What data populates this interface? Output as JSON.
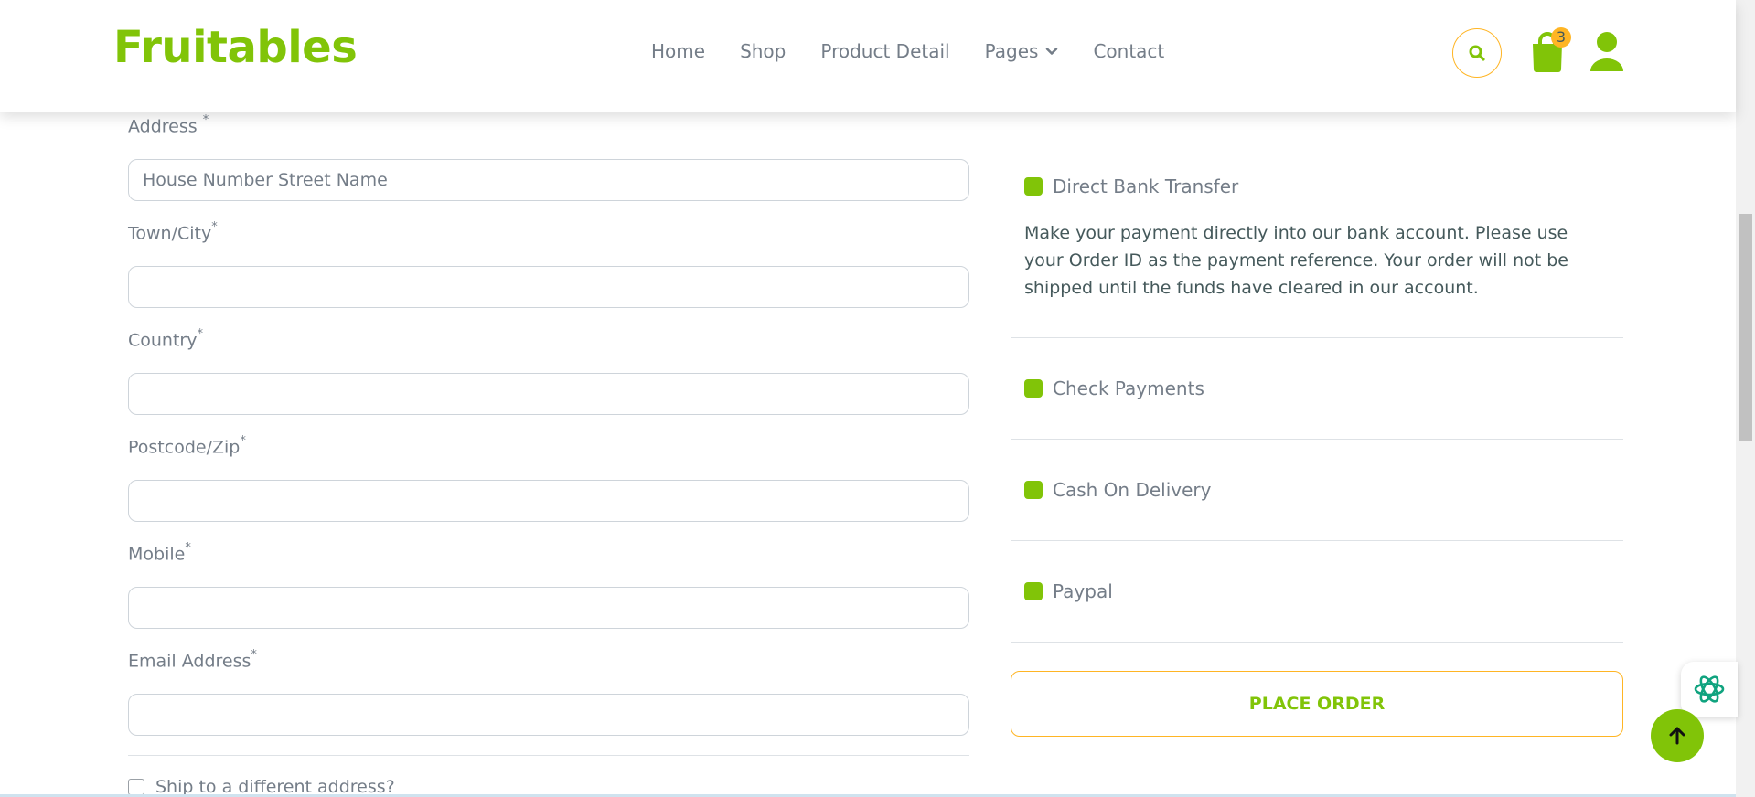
{
  "header": {
    "brand": "Fruitables",
    "nav": [
      "Home",
      "Shop",
      "Product Detail",
      "Pages",
      "Contact"
    ],
    "cart_count": "3",
    "icons": [
      "search-icon",
      "shopping-bag-icon",
      "user-icon"
    ]
  },
  "form": {
    "address": {
      "label": "Address",
      "required": "*",
      "placeholder": "House Number Street Name",
      "value": ""
    },
    "town": {
      "label": "Town/City",
      "required": "*",
      "value": ""
    },
    "country": {
      "label": "Country",
      "required": "*",
      "value": ""
    },
    "postcode": {
      "label": "Postcode/Zip",
      "required": "*",
      "value": ""
    },
    "mobile": {
      "label": "Mobile",
      "required": "*",
      "value": ""
    },
    "email": {
      "label": "Email Address",
      "required": "*",
      "value": ""
    },
    "ship_different": "Ship to a different address?"
  },
  "payment": {
    "options": [
      "Direct Bank Transfer",
      "Check Payments",
      "Cash On Delivery",
      "Paypal"
    ],
    "bank_description": "Make your payment directly into our bank account. Please use your Order ID as the payment reference. Your order will not be shipped until the funds have cleared in our account.",
    "place_order": "PLACE ORDER"
  },
  "colors": {
    "brand_green": "#81c408",
    "accent_orange": "#ffb524",
    "text_gray": "#747d88",
    "text_dark": "#45595b"
  }
}
